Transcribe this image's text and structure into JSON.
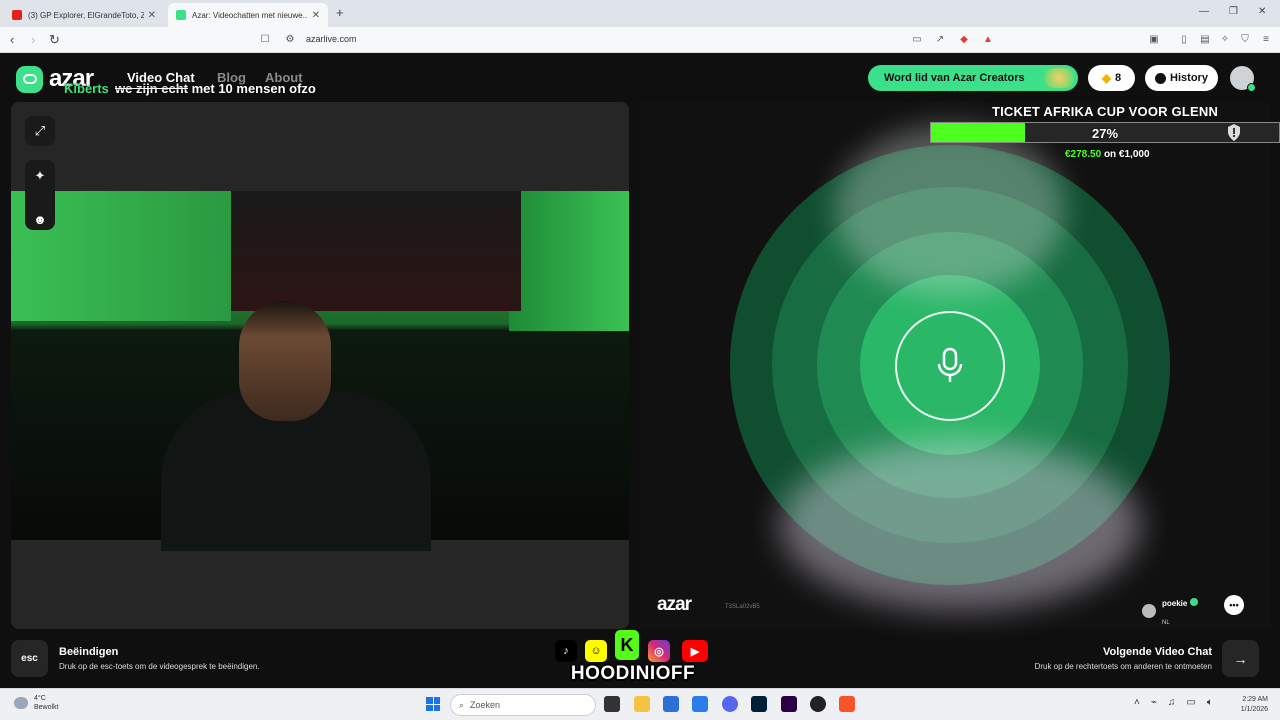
{
  "browser": {
    "tabs": [
      {
        "title": "(3) GP Explorer, ElGrandeToto, Zed, L...",
        "favicon_color": "#e62117"
      },
      {
        "title": "Azar: Videochatten met nieuwe...",
        "favicon_color": "#3de08a"
      }
    ],
    "url": "azarlive.com"
  },
  "header": {
    "logo_text": "azar",
    "nav": [
      "Video Chat",
      "Blog",
      "About"
    ],
    "creators_button": "Word lid van Azar Creators",
    "gem_count": "8",
    "history_button": "History"
  },
  "stream_overlay": {
    "name": "Kiberts",
    "struck_text": "we zijn echt",
    "message": "met 10 mensen ofzo"
  },
  "goal": {
    "title": "TICKET AFRIKA CUP VOOR GLENN",
    "percent_label": "27%",
    "progress": 0.27,
    "amount": "€278.50",
    "of_label": "on €1,000"
  },
  "remote": {
    "logo_text": "azar",
    "session_id": "T3SLa02vB5",
    "peer_name": "poekie",
    "peer_country": "NL"
  },
  "bottom": {
    "esc_key": "esc",
    "end_title": "Beëindigen",
    "end_desc": "Druk op de esc-toets om de videogesprek te beëindigen.",
    "next_title": "Volgende Video Chat",
    "next_desc": "Druk op de rechtertoets om anderen te ontmoeten"
  },
  "socials": {
    "handle": "HOODINIOFF",
    "icons": [
      "tiktok-icon",
      "snapchat-icon",
      "kick-icon",
      "instagram-icon",
      "youtube-icon"
    ]
  },
  "taskbar": {
    "weather_temp": "4°C",
    "weather_desc": "Bewolkt",
    "search_placeholder": "Zoeken",
    "time": "2:29 AM",
    "date": "1/1/2026"
  },
  "colors": {
    "accent": "#3de08a",
    "goal_fill": "#4cff1f",
    "panel": "#262626"
  }
}
